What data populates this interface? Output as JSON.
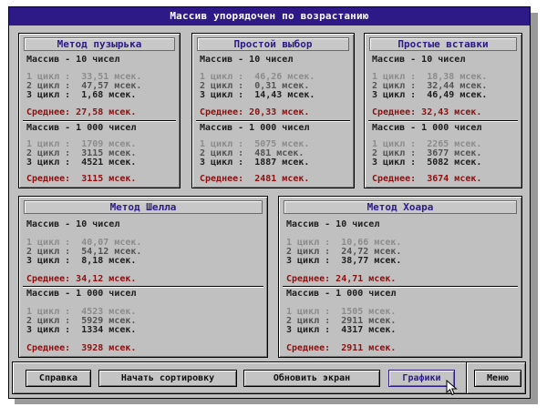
{
  "window": {
    "title": "Массив упорядочен по возрастанию"
  },
  "panels": [
    {
      "title": "Метод пузырька",
      "small": {
        "header": "Массив - 10 чисел",
        "rows": [
          "1 цикл :  33,51 мсек.",
          "2 цикл :  47,57 мсек.",
          "3 цикл :  1,68 мсек."
        ],
        "avg": "Среднее: 27,58 мсек."
      },
      "large": {
        "header": "Массив - 1 000 чисел",
        "rows": [
          "1 цикл :  1709 мсек.",
          "2 цикл :  3115 мсек.",
          "3 цикл :  4521 мсек."
        ],
        "avg": "Среднее:  3115 мсек."
      }
    },
    {
      "title": "Простой выбор",
      "small": {
        "header": "Массив - 10 чисел",
        "rows": [
          "1 цикл :  46,26 мсек.",
          "2 цикл :  0,31 мсек.",
          "3 цикл :  14,43 мсек."
        ],
        "avg": "Среднее: 20,33 мсек."
      },
      "large": {
        "header": "Массив - 1 000 чисел",
        "rows": [
          "1 цикл :  5075 мсек.",
          "2 цикл :  481 мсек.",
          "3 цикл :  1887 мсек."
        ],
        "avg": "Среднее:  2481 мсек."
      }
    },
    {
      "title": "Простые вставки",
      "small": {
        "header": "Массив - 10 чисел",
        "rows": [
          "1 цикл :  18,38 мсек.",
          "2 цикл :  32,44 мсек.",
          "3 цикл :  46,49 мсек."
        ],
        "avg": "Среднее: 32,43 мсек."
      },
      "large": {
        "header": "Массив - 1 000 чисел",
        "rows": [
          "1 цикл :  2265 мсек.",
          "2 цикл :  3677 мсек.",
          "3 цикл :  5082 мсек."
        ],
        "avg": "Среднее:  3674 мсек."
      }
    },
    {
      "title": "Метод Шелла",
      "small": {
        "header": "Массив - 10 чисел",
        "rows": [
          "1 цикл :  40,07 мсек.",
          "2 цикл :  54,12 мсек.",
          "3 цикл :  8,18 мсек."
        ],
        "avg": "Среднее: 34,12 мсек."
      },
      "large": {
        "header": "Массив - 1 000 чисел",
        "rows": [
          "1 цикл :  4523 мсек.",
          "2 цикл :  5929 мсек.",
          "3 цикл :  1334 мсек."
        ],
        "avg": "Среднее:  3928 мсек."
      }
    },
    {
      "title": "Метод Хоара",
      "small": {
        "header": "Массив - 10 чисел",
        "rows": [
          "1 цикл :  10,66 мсек.",
          "2 цикл :  24,72 мсек.",
          "3 цикл :  38,77 мсек."
        ],
        "avg": "Среднее: 24,71 мсек."
      },
      "large": {
        "header": "Массив - 1 000 чисел",
        "rows": [
          "1 цикл :  1505 мсек.",
          "2 цикл :  2911 мсек.",
          "3 цикл :  4317 мсек."
        ],
        "avg": "Среднее:  2911 мсек."
      }
    }
  ],
  "buttons": {
    "help": "Справка",
    "start_sort": "Начать сортировку",
    "refresh": "Обновить экран",
    "charts": "Графики",
    "menu": "Меню"
  },
  "colors": {
    "title_bar": "#2d1a86",
    "average_text": "#8b1010",
    "panel_bg": "#c0c0c0"
  },
  "cursor": {
    "icon": "arrow-pointer-icon"
  }
}
